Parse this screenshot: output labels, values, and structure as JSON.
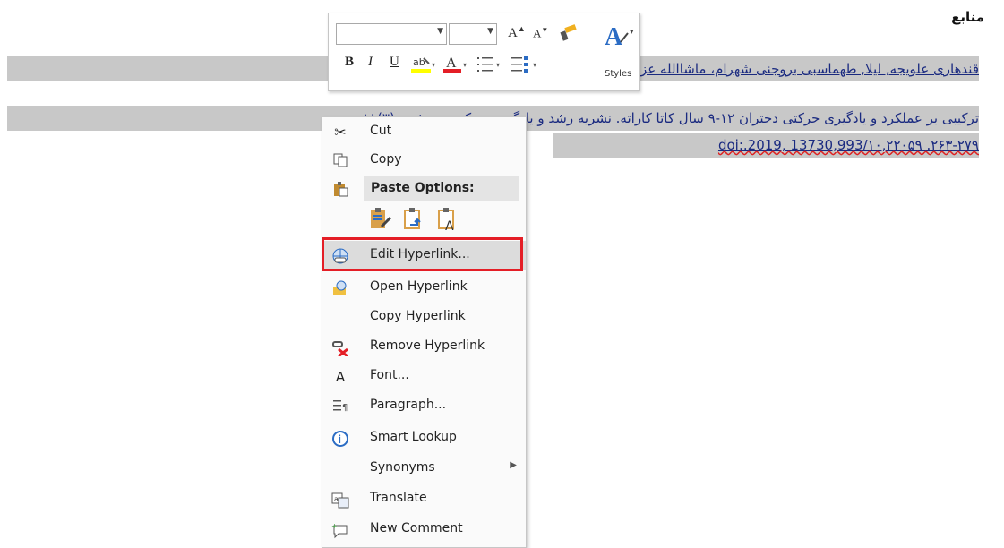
{
  "document": {
    "heading": "منابع",
    "reference_line1": "قندهاری علویجه, لیلا, طهماسبی بروجنی شهرام، ماشاالله عزیزی، تأثیر تمرینات تقلیدی فوری، دوره ای و",
    "reference_line2": "ترکیبی بر عملکرد و یادگیری حرکتی دختران ۱۲-۹ سال کاتا کاراته. نشریه رشد و یادگیری حرکتی ورزشی، (۳)۱۱،",
    "reference_line3": "doi:.2019, 13730,993/۱۰,۲۲۰۵۹ .۲۶۳-۲۷۹"
  },
  "mini_toolbar": {
    "font_name": "",
    "font_size": "",
    "grow_font_icon": "A",
    "shrink_font_icon": "A",
    "bold": "B",
    "italic": "I",
    "underline": "U",
    "font_color_letter": "A",
    "styles_label": "Styles",
    "highlight_color": "#ffff00",
    "font_color": "#e41e26"
  },
  "context_menu": {
    "cut": "Cut",
    "copy": "Copy",
    "paste_options": "Paste Options:",
    "edit_hyperlink": "Edit Hyperlink...",
    "open_hyperlink": "Open Hyperlink",
    "copy_hyperlink": "Copy Hyperlink",
    "remove_hyperlink": "Remove Hyperlink",
    "font": "Font...",
    "paragraph": "Paragraph...",
    "smart_lookup": "Smart Lookup",
    "synonyms": "Synonyms",
    "translate": "Translate",
    "new_comment": "New Comment"
  },
  "colors": {
    "selection": "#c8c8c8",
    "link": "#1a2a80",
    "highlight_box": "#e41e26",
    "accent_blue": "#2b6cc4"
  }
}
